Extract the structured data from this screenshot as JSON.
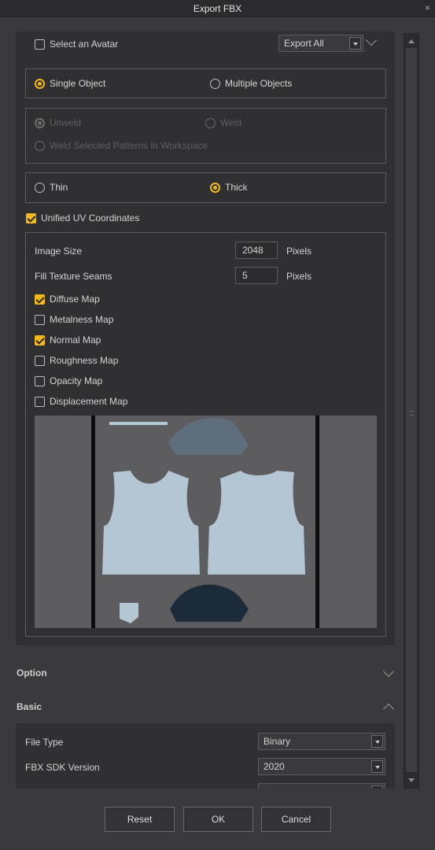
{
  "window": {
    "title": "Export FBX",
    "close_glyph": "×"
  },
  "avatar": {
    "label": "Select an Avatar",
    "checked": false,
    "export_value": "Export All"
  },
  "object_mode": {
    "single": "Single Object",
    "multiple": "Multiple Objects",
    "selected": "single"
  },
  "weld": {
    "unweld": "Unweld",
    "weld": "Weld",
    "selected_patterns": "Weld Selected Patterns in Workspace",
    "disabled": true
  },
  "thickness": {
    "thin": "Thin",
    "thick": "Thick",
    "selected": "thick"
  },
  "uv": {
    "label": "Unified UV Coordinates",
    "checked": true
  },
  "texture": {
    "image_size_label": "Image Size",
    "image_size_value": "2048",
    "image_size_unit": "Pixels",
    "fill_seams_label": "Fill Texture Seams",
    "fill_seams_value": "5",
    "fill_seams_unit": "Pixels",
    "maps": [
      {
        "label": "Diffuse Map",
        "checked": true
      },
      {
        "label": "Metalness Map",
        "checked": false
      },
      {
        "label": "Normal Map",
        "checked": true
      },
      {
        "label": "Roughness Map",
        "checked": false
      },
      {
        "label": "Opacity Map",
        "checked": false
      },
      {
        "label": "Displacement Map",
        "checked": false
      }
    ]
  },
  "sections": {
    "option": "Option",
    "basic": "Basic"
  },
  "basic": {
    "file_type_label": "File Type",
    "file_type_value": "Binary",
    "sdk_label": "FBX SDK Version",
    "sdk_value": "2020"
  },
  "buttons": {
    "reset": "Reset",
    "ok": "OK",
    "cancel": "Cancel"
  },
  "colors": {
    "accent": "#f2b722",
    "uv_light": "#b4c6d4",
    "uv_mid": "#5e6e7c",
    "uv_dark": "#1c2b3a"
  }
}
